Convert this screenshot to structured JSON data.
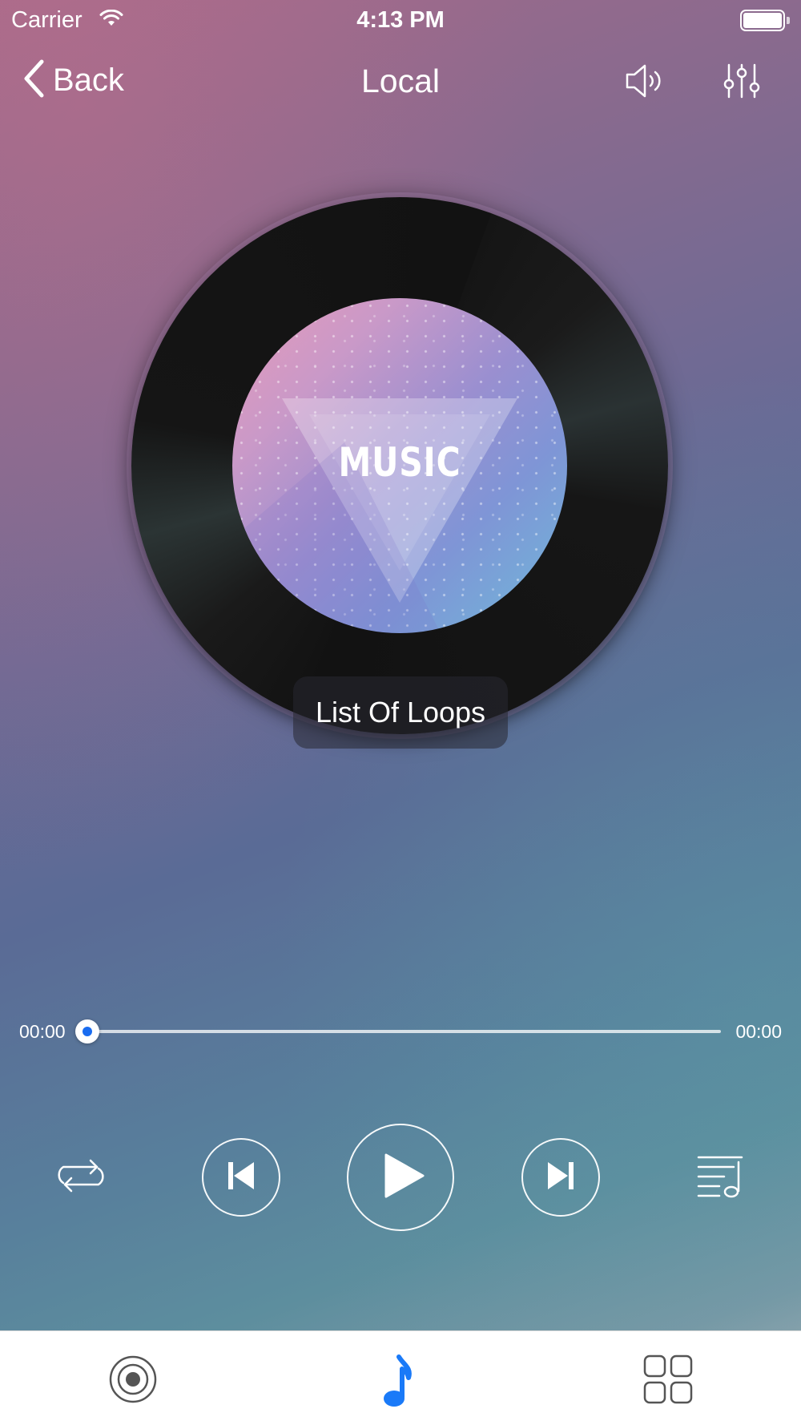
{
  "status_bar": {
    "carrier": "Carrier",
    "time": "4:13 PM",
    "wifi_icon": "wifi-icon",
    "battery_icon": "battery-icon"
  },
  "nav": {
    "back_label": "Back",
    "title": "Local",
    "icons": [
      "chevron-left-icon",
      "volume-icon",
      "equalizer-icon"
    ]
  },
  "album": {
    "art_text": "MUSIC",
    "song_title": "List Of Loops"
  },
  "player": {
    "elapsed": "00:00",
    "duration": "00:00",
    "progress": 0,
    "controls": [
      "repeat-icon",
      "previous-icon",
      "play-icon",
      "next-icon",
      "playlist-icon"
    ]
  },
  "tabbar": {
    "items": [
      "radio-target-icon",
      "music-note-icon",
      "grid-icon"
    ],
    "active_index": 1,
    "active_color": "#1a7af8",
    "inactive_color": "#555555"
  },
  "colors": {
    "accent": "#1a7af8",
    "text": "#ffffff"
  }
}
